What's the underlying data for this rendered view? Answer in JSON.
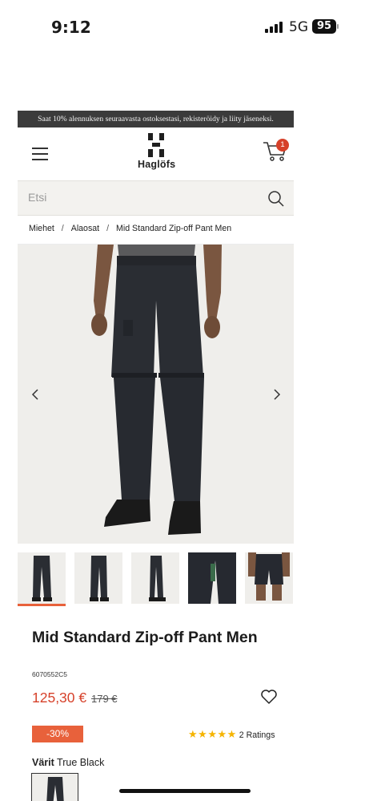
{
  "status_bar": {
    "time": "9:12",
    "network": "5G",
    "battery": "95"
  },
  "promo_banner": "Saat 10% alennuksen seuraavasta ostoksestasi, rekisteröidy ja liity jäseneksi.",
  "header": {
    "brand": "Haglöfs",
    "cart_count": "1"
  },
  "search": {
    "placeholder": "Etsi"
  },
  "breadcrumb": {
    "items": [
      "Miehet",
      "Alaosat",
      "Mid Standard Zip-off Pant Men"
    ],
    "separator": "/"
  },
  "product": {
    "title": "Mid Standard Zip-off Pant Men",
    "sku": "6070552C5",
    "price": "125,30  €",
    "old_price": "179 €",
    "discount": "-30%",
    "rating_count": "2 Ratings",
    "stars": 5,
    "color_label": "Värit",
    "color_value": "True Black",
    "thumbnail_count": 5,
    "accent": "#e8613b",
    "price_color": "#d6412a"
  }
}
